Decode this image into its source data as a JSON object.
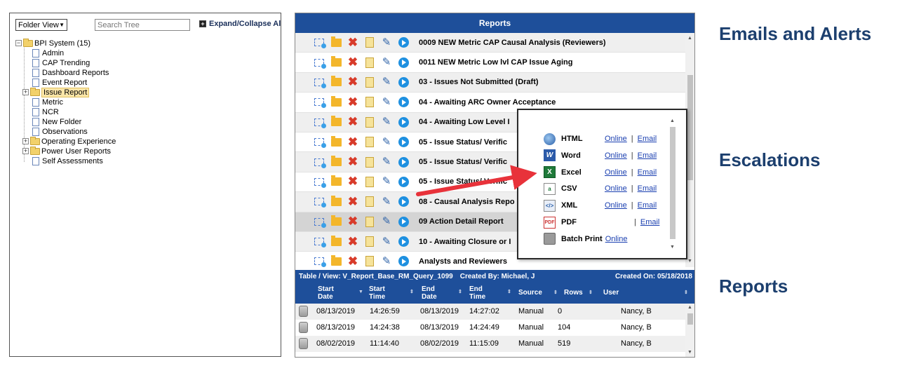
{
  "tree_panel": {
    "folder_view": "Folder View",
    "search_placeholder": "Search Tree",
    "expand_label": "Expand/Collapse All",
    "root": "BPI System (15)",
    "items": [
      {
        "label": "Admin",
        "type": "doc"
      },
      {
        "label": "CAP Trending",
        "type": "doc"
      },
      {
        "label": "Dashboard Reports",
        "type": "doc"
      },
      {
        "label": "Event Report",
        "type": "doc"
      },
      {
        "label": "Issue Report",
        "type": "folder",
        "selected": true
      },
      {
        "label": "Metric",
        "type": "doc"
      },
      {
        "label": "NCR",
        "type": "doc"
      },
      {
        "label": "New Folder",
        "type": "doc"
      },
      {
        "label": "Observations",
        "type": "doc"
      },
      {
        "label": "Operating Experience",
        "type": "folder"
      },
      {
        "label": "Power User Reports",
        "type": "folder"
      },
      {
        "label": "Self Assessments",
        "type": "doc"
      }
    ]
  },
  "reports": {
    "header": "Reports",
    "rows": [
      "0009 NEW Metric CAP Causal Analysis (Reviewers)",
      "0011 NEW Metric Low lvl CAP Issue Aging",
      "03 - Issues Not Submitted (Draft)",
      "04 - Awaiting ARC Owner Acceptance",
      "04 - Awaiting Low Level I",
      "05 - Issue Status/ Verific",
      "05 - Issue Status/ Verific",
      "05 - Issue Status/ Verific",
      "08 - Causal Analysis Repo",
      "09 Action Detail Report",
      "10 - Awaiting Closure or I",
      "Analysts and Reviewers"
    ],
    "meta": {
      "table_view": "Table / View:  V_Report_Base_RM_Query_1099",
      "created_by": "Created By:  Michael, J",
      "created_on": "Created On:  05/18/2018"
    },
    "columns": {
      "start_date_1": "Start",
      "start_date_2": "Date",
      "start_time_1": "Start",
      "start_time_2": "Time",
      "end_date_1": "End",
      "end_date_2": "Date",
      "end_time_1": "End",
      "end_time_2": "Time",
      "source": "Source",
      "rows": "Rows",
      "user": "User"
    },
    "history": [
      {
        "start_date": "08/13/2019",
        "start_time": "14:26:59",
        "end_date": "08/13/2019",
        "end_time": "14:27:02",
        "source": "Manual",
        "rows": "0",
        "user": "Nancy, B"
      },
      {
        "start_date": "08/13/2019",
        "start_time": "14:24:38",
        "end_date": "08/13/2019",
        "end_time": "14:24:49",
        "source": "Manual",
        "rows": "104",
        "user": "Nancy, B"
      },
      {
        "start_date": "08/02/2019",
        "start_time": "11:14:40",
        "end_date": "08/02/2019",
        "end_time": "11:15:09",
        "source": "Manual",
        "rows": "519",
        "user": "Nancy, B"
      }
    ]
  },
  "export_popup": {
    "online": "Online",
    "email": "Email",
    "sep": "|",
    "formats": [
      {
        "label": "HTML",
        "icon": "globe-icon"
      },
      {
        "label": "Word",
        "icon": "word-icon"
      },
      {
        "label": "Excel",
        "icon": "excel-icon"
      },
      {
        "label": "CSV",
        "icon": "csv-icon"
      },
      {
        "label": "XML",
        "icon": "xml-icon"
      },
      {
        "label": "PDF",
        "icon": "pdf-icon"
      },
      {
        "label": "Batch Print",
        "icon": "printer-icon"
      }
    ]
  },
  "headings": {
    "emails": "Emails and Alerts",
    "escalations": "Escalations",
    "reports": "Reports"
  },
  "colors": {
    "header_blue": "#1e4f9a",
    "heading_navy": "#1c3f6e",
    "arrow_red": "#e8323a",
    "link_blue": "#1a3fb0"
  }
}
